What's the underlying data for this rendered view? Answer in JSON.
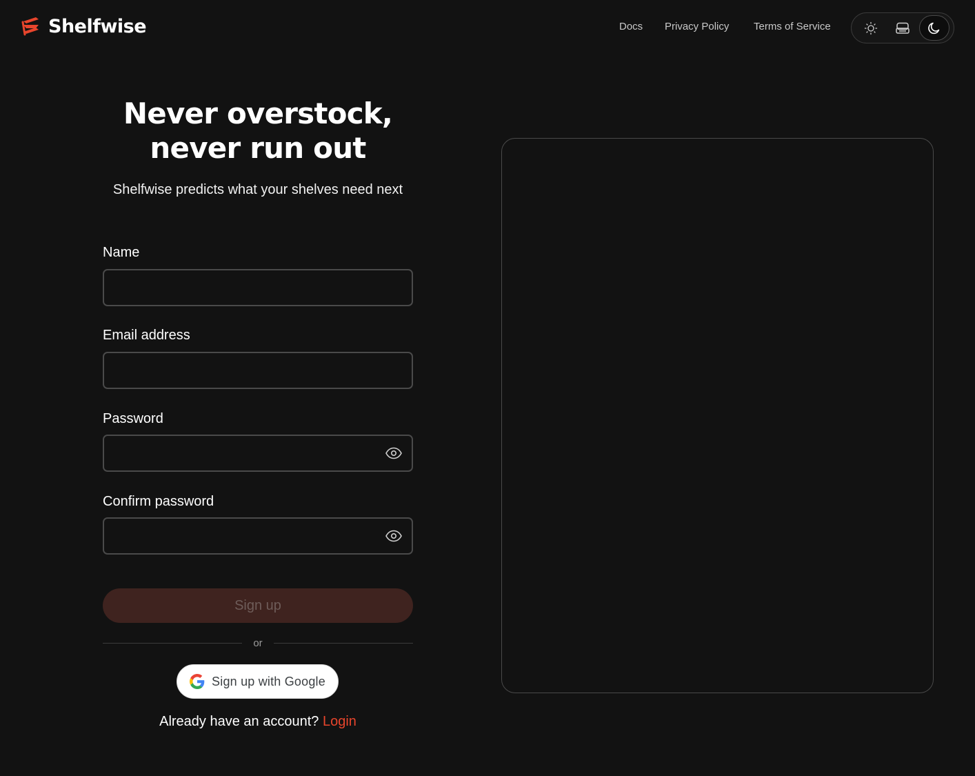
{
  "brand": {
    "name": "Shelfwise",
    "accent_color": "#e8452c"
  },
  "nav": {
    "links": [
      {
        "label": "Docs"
      },
      {
        "label": "Privacy Policy"
      },
      {
        "label": "Terms of Service"
      }
    ]
  },
  "theme_switch": {
    "options": [
      "sun-icon",
      "monitor-icon",
      "moon-icon"
    ],
    "selected": "dark"
  },
  "hero": {
    "title_line1": "Never overstock,",
    "title_line2": "never run out",
    "subtitle": "Shelfwise predicts what your shelves need next"
  },
  "form": {
    "name": {
      "label": "Name",
      "value": ""
    },
    "email": {
      "label": "Email address",
      "value": ""
    },
    "password": {
      "label": "Password",
      "value": ""
    },
    "confirm_password": {
      "label": "Confirm password",
      "value": ""
    },
    "submit_label": "Sign up",
    "divider_text": "or",
    "google_label": "Sign up with Google",
    "login_prompt": "Already have an account?",
    "login_link": "Login"
  }
}
